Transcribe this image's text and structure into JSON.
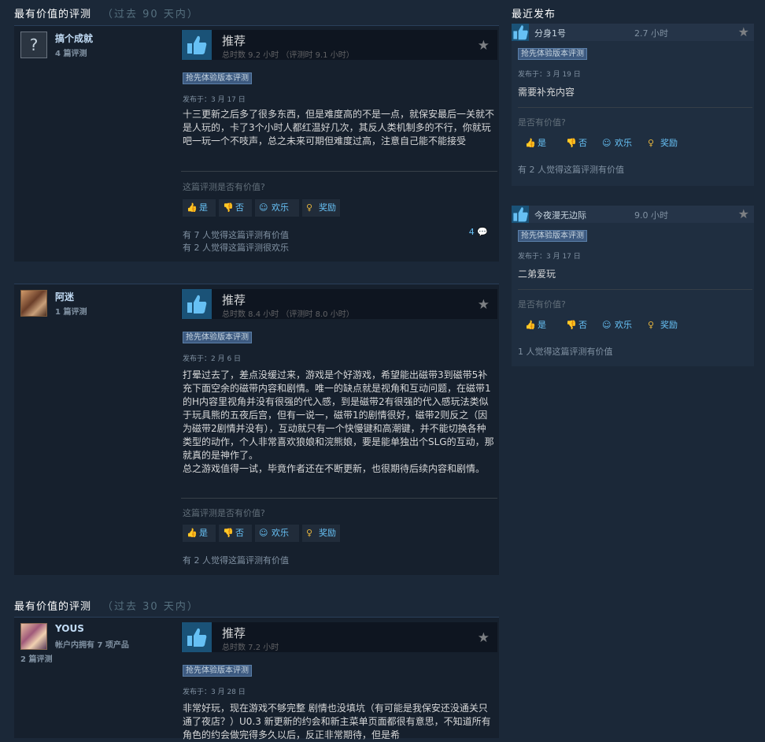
{
  "sections": {
    "top90": {
      "title": "最有价值的评测",
      "period": "（过去 90 天内）"
    },
    "recent": {
      "title": "最近发布"
    },
    "top30": {
      "title": "最有价值的评测",
      "period": "（过去 30 天内）"
    }
  },
  "common": {
    "recommend_label": "推荐",
    "ea_badge": "抢先体验版本评测",
    "helpful_question": "这篇评测是否有价值?",
    "side_helpful_question": "是否有价值?",
    "btn_yes": "是",
    "btn_no": "否",
    "btn_funny": "欢乐",
    "btn_award": "奖励",
    "colors": {
      "bg": "#1b2838",
      "accent": "#67c1f5",
      "badge": "#3d5a80",
      "award": "#e2b23d"
    }
  },
  "reviews": [
    {
      "author": "搞个成就",
      "author_meta": "4 篇评测",
      "avatar_icon": "question-mark-avatar",
      "hours": "总时数 9.2 小时 （评测时 9.1 小时）",
      "posted": "发布于：3 月 17 日",
      "text": "十三更新之后多了很多东西，但是难度高的不是一点，就保安最后一关就不是人玩的，卡了3个小时人都红温好几次，其反人类机制多的不行，你就玩吧一玩一个不吱声，总之未来可期但难度过高，注意自己能不能接受",
      "stat1": "有 7 人觉得这篇评测有价值",
      "stat2": "有 2 人觉得这篇评测很欢乐",
      "comments": "4"
    },
    {
      "author": "阿迷",
      "author_meta": "1 篇评测",
      "avatar_icon": "anime-avatar",
      "hours": "总时数 8.4 小时 （评测时 8.0 小时）",
      "posted": "发布于：2 月 6 日",
      "text": "打晕过去了，差点没缓过来，游戏是个好游戏，希望能出磁带3到磁带5补充下面空余的磁带内容和剧情。唯一的缺点就是视角和互动问题，在磁带1的H内容里视角并没有很强的代入感，到是磁带2有很强的代入感玩法类似于玩具熊的五夜后宫，但有一说一，磁带1的剧情很好，磁带2则反之（因为磁带2剧情并没有），互动就只有一个快慢键和高潮键，并不能切换各种类型的动作，个人非常喜欢狼娘和浣熊娘，要是能单独出个SLG的互动，那就真的是神作了。\n总之游戏值得一试，毕竟作者还在不断更新，也很期待后续内容和剧情。",
      "stat1": "有 2 人觉得这篇评测有价值"
    },
    {
      "author": "YOUS",
      "author_meta": "帐户内拥有 7 项产品",
      "author_meta2": "2 篇评测",
      "avatar_icon": "anime-avatar",
      "hours": "总时数 7.2 小时",
      "posted": "发布于：3 月 28 日",
      "text": "非常好玩，现在游戏不够完整 剧情也没填坑（有可能是我保安还没通关只通了夜店？）U0.3 新更新的约会和新主菜单页面都很有意思，不知道所有角色的约会做完得多久以后，反正非常期待，但是希"
    }
  ],
  "recent": [
    {
      "author": "分身1号",
      "hours": "2.7 小时",
      "posted": "发布于：3 月 19 日",
      "text": "需要补充内容",
      "stat": "有 2 人觉得这篇评测有价值"
    },
    {
      "author": "今夜漫无边际",
      "hours": "9.0 小时",
      "posted": "发布于：3 月 17 日",
      "text": "二弟爱玩",
      "stat": "1 人觉得这篇评测有价值"
    }
  ]
}
